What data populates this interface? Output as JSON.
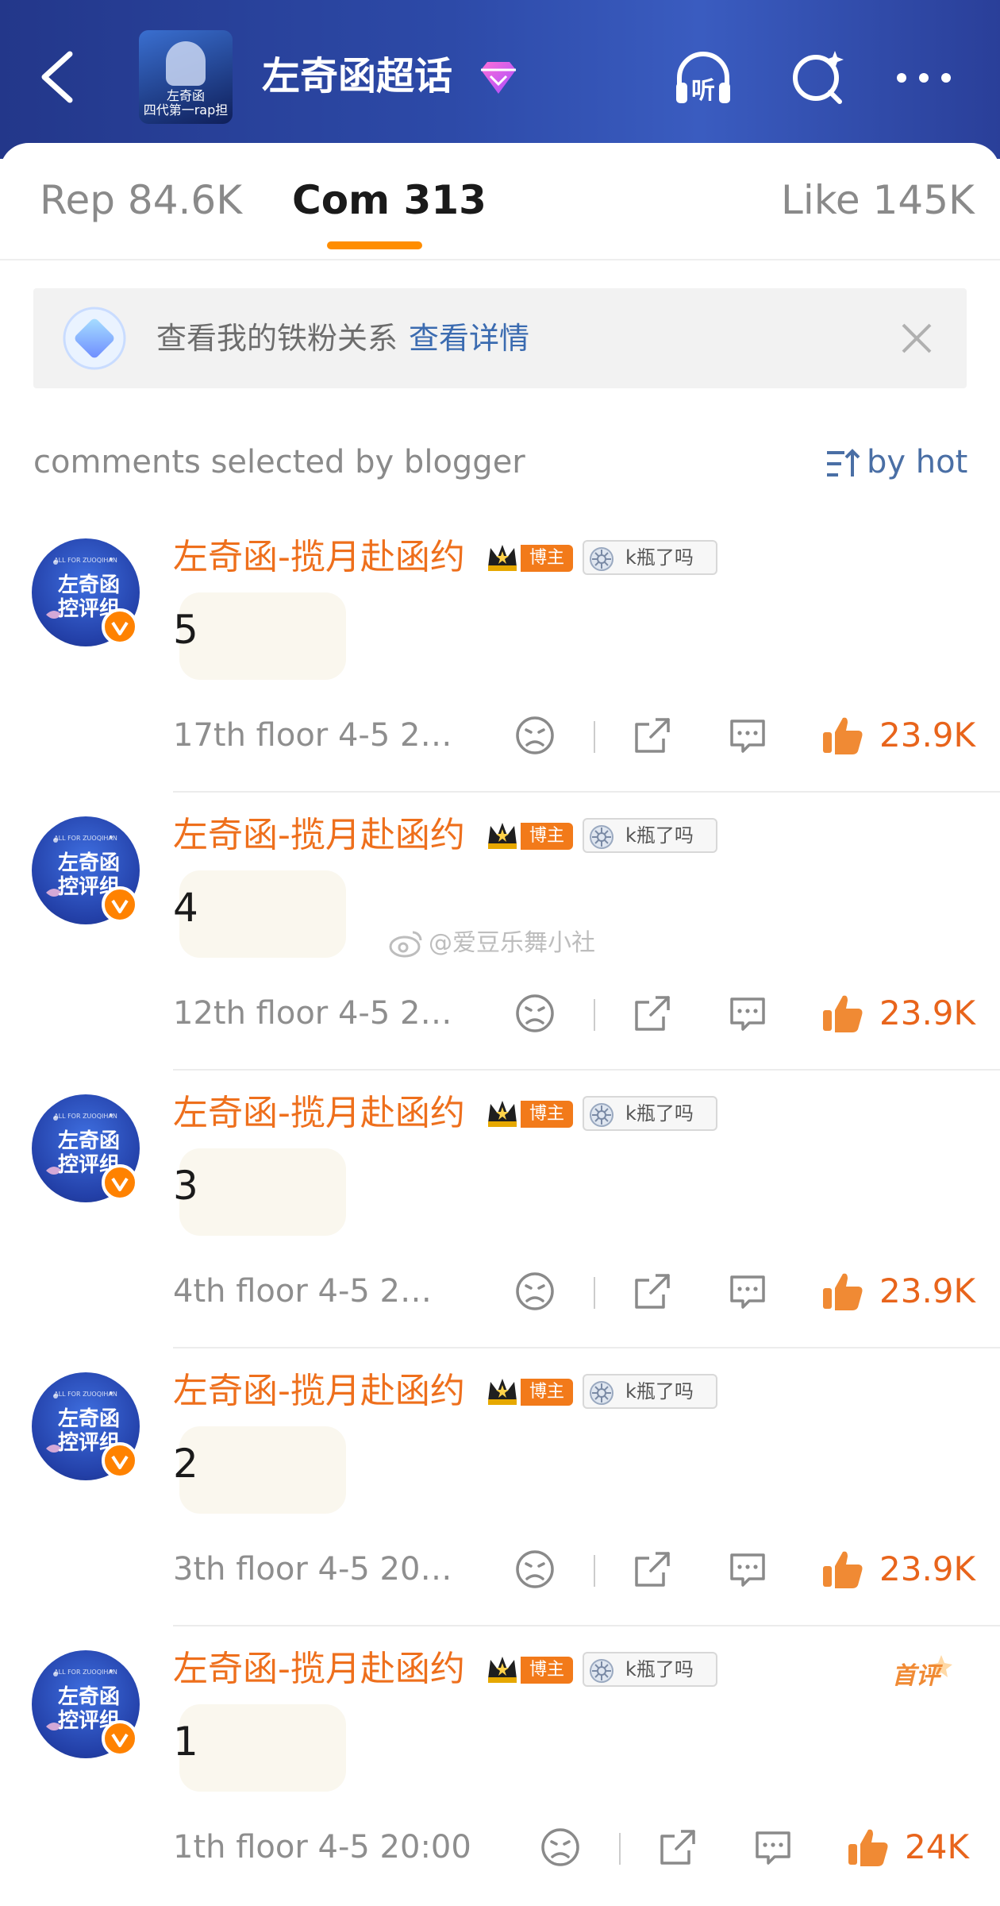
{
  "header": {
    "title": "左奇函超话",
    "cover_caption_1": "左奇函",
    "cover_caption_2": "四代第一rap担",
    "listen_label": "听",
    "icons": [
      "back-arrow-icon",
      "listen-headphone-icon",
      "search-icon",
      "more-icon"
    ]
  },
  "tabs": [
    {
      "label": "Rep 84.6K",
      "active": false
    },
    {
      "label": "Com 313",
      "active": true
    },
    {
      "label": "Like 145K",
      "active": false
    }
  ],
  "banner": {
    "text": "查看我的铁粉关系",
    "link": "查看详情"
  },
  "section": {
    "label": "comments selected by blogger",
    "sort_label": "by hot"
  },
  "comments": [
    {
      "username": "左奇函-揽月赴函约",
      "role_tag": "博主",
      "badge": "k瓶了吗",
      "text": "5",
      "meta": "17th floor 4-5 2…",
      "likes": "23.9K",
      "avatar_text": "左奇函 控评组",
      "first": false
    },
    {
      "username": "左奇函-揽月赴函约",
      "role_tag": "博主",
      "badge": "k瓶了吗",
      "text": "4",
      "meta": "12th floor 4-5 2…",
      "likes": "23.9K",
      "avatar_text": "左奇函 控评组",
      "first": false
    },
    {
      "username": "左奇函-揽月赴函约",
      "role_tag": "博主",
      "badge": "k瓶了吗",
      "text": "3",
      "meta": "4th floor 4-5 2…",
      "likes": "23.9K",
      "avatar_text": "左奇函 控评组",
      "first": false
    },
    {
      "username": "左奇函-揽月赴函约",
      "role_tag": "博主",
      "badge": "k瓶了吗",
      "text": "2",
      "meta": "3th floor 4-5 20…",
      "likes": "23.9K",
      "avatar_text": "左奇函 控评组",
      "first": false
    },
    {
      "username": "左奇函-揽月赴函约",
      "role_tag": "博主",
      "badge": "k瓶了吗",
      "text": "1",
      "meta": "1th floor 4-5 20:00",
      "likes": "24K",
      "avatar_text": "左奇函 控评组",
      "first": true,
      "first_label": "首评"
    }
  ],
  "watermark": "@爱豆乐舞小社",
  "colors": {
    "accent": "#ff8d00",
    "username": "#ee6f1c",
    "link": "#3b6bb0",
    "header": "#2d4aa8"
  }
}
